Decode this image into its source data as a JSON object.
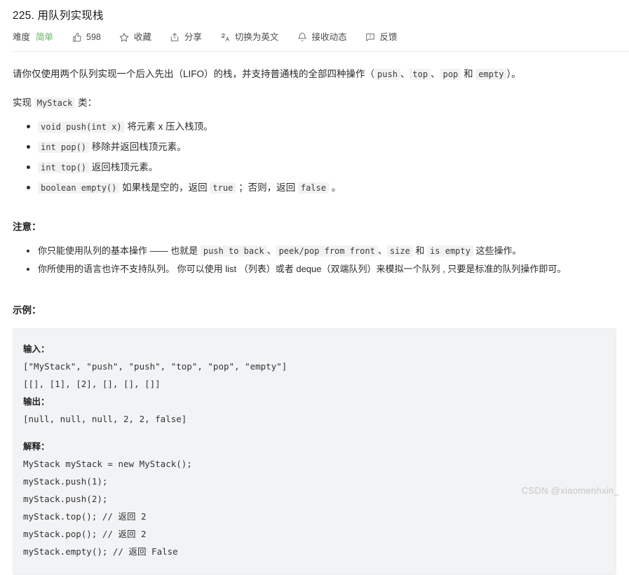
{
  "problem": {
    "number": "225.",
    "title": "用队列实现栈",
    "full_title": "225. 用队列实现栈"
  },
  "toolbar": {
    "difficulty_label": "难度",
    "difficulty_value": "简单",
    "difficulty_color": "#5fb85f",
    "likes": "598",
    "favorite": "收藏",
    "share": "分享",
    "translate": "切换为英文",
    "subscribe": "接收动态",
    "feedback": "反馈",
    "icons": {
      "like": "thumbs-up-icon",
      "favorite": "star-icon",
      "share": "share-icon",
      "translate": "translate-icon",
      "subscribe": "bell-icon",
      "feedback": "feedback-icon"
    }
  },
  "description": {
    "intro_p1": "请你仅使用两个队列实现一个后入先出（LIFO）的栈，并支持普通栈的全部四种操作（",
    "intro_code_push": "push",
    "intro_sep1": "、",
    "intro_code_top": "top",
    "intro_sep2": "、",
    "intro_code_pop": "pop",
    "intro_and": "和",
    "intro_code_empty": "empty",
    "intro_p2": "）。",
    "implement_prefix": "实现",
    "implement_class": "MyStack",
    "implement_suffix": "类：",
    "methods": [
      {
        "code": "void push(int x)",
        "text": "将元素 x 压入栈顶。"
      },
      {
        "code": "int pop()",
        "text": "移除并返回栈顶元素。"
      },
      {
        "code": "int top()",
        "text": "返回栈顶元素。"
      },
      {
        "code": "boolean empty()",
        "text_a": "如果栈是空的，返回",
        "code_true": "true",
        "text_b": "；否则，返回",
        "code_false": "false",
        "text_c": "。"
      }
    ]
  },
  "notes": {
    "heading": "注意：",
    "items": [
      {
        "text_a": "你只能使用队列的基本操作 —— 也就是",
        "code_1": "push to back",
        "sep_1": "、",
        "code_2": "peek/pop from front",
        "sep_2": "、",
        "code_3": "size",
        "and": "和",
        "code_4": "is empty",
        "text_b": "这些操作。"
      },
      {
        "text_full": "你所使用的语言也许不支持队列。 你可以使用 list （列表）或者 deque（双端队列）来模拟一个队列 , 只要是标准的队列操作即可。"
      }
    ]
  },
  "example": {
    "heading": "示例：",
    "input_label": "输入：",
    "input_lines": [
      "[\"MyStack\", \"push\", \"push\", \"top\", \"pop\", \"empty\"]",
      "[[], [1], [2], [], [], []]"
    ],
    "output_label": "输出：",
    "output_lines": [
      "[null, null, null, 2, 2, false]"
    ],
    "explain_label": "解释：",
    "explain_lines": [
      "MyStack myStack = new MyStack();",
      "myStack.push(1);",
      "myStack.push(2);",
      "myStack.top(); // 返回 2",
      "myStack.pop(); // 返回 2",
      "myStack.empty(); // 返回 False"
    ]
  },
  "watermark": {
    "text": "CSDN @xiaomenhxin_"
  }
}
